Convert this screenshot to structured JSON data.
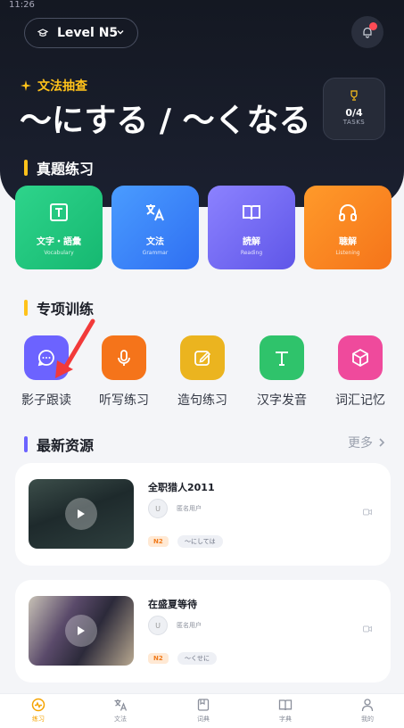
{
  "status_bar": {
    "time": "11:26"
  },
  "header": {
    "level_label": "Level N5",
    "grammar_tag": "文法抽查",
    "title": "～にする / ～くなる",
    "tasks_count": "0/4",
    "tasks_label": "TASKS"
  },
  "sections": {
    "exam": "真题练习",
    "training": "专项训练",
    "resources": "最新资源",
    "more": "更多"
  },
  "exam_cards": [
    {
      "cn": "文字・語彙",
      "en": "Vocabulary",
      "icon": "text-icon",
      "color": "#1fc57d"
    },
    {
      "cn": "文法",
      "en": "Grammar",
      "icon": "translate-icon",
      "color": "#3a86f7"
    },
    {
      "cn": "読解",
      "en": "Reading",
      "icon": "book-icon",
      "color": "#6f66f0"
    },
    {
      "cn": "聴解",
      "en": "Listening",
      "icon": "headphones-icon",
      "color": "#f68320"
    }
  ],
  "training": [
    {
      "label": "影子跟读",
      "icon": "chat-icon",
      "color": "#6c63ff"
    },
    {
      "label": "听写练习",
      "icon": "microphone-icon",
      "color": "#f5741a"
    },
    {
      "label": "造句练习",
      "icon": "edit-icon",
      "color": "#ebb41f"
    },
    {
      "label": "汉字发音",
      "icon": "font-t-icon",
      "color": "#2fc36b"
    },
    {
      "label": "词汇记忆",
      "icon": "cube-icon",
      "color": "#ef4a9c"
    }
  ],
  "resources": [
    {
      "title": "全职猎人2011",
      "avatar": "U",
      "author": "匿名用户",
      "level": "N2",
      "tag": "～にしては"
    },
    {
      "title": "在盛夏等待",
      "avatar": "U",
      "author": "匿名用户",
      "level": "N2",
      "tag": "～くせに"
    }
  ],
  "nav": [
    {
      "label": "练习",
      "icon": "practice-icon",
      "active": true
    },
    {
      "label": "文法",
      "icon": "grammar-icon",
      "active": false
    },
    {
      "label": "词典",
      "icon": "dictionary-icon",
      "active": false
    },
    {
      "label": "字典",
      "icon": "kanji-book-icon",
      "active": false
    },
    {
      "label": "我的",
      "icon": "profile-icon",
      "active": false
    }
  ],
  "colors": {
    "accent": "#ffc21a",
    "active_nav": "#f5a300",
    "notification": "#ff4b55"
  }
}
